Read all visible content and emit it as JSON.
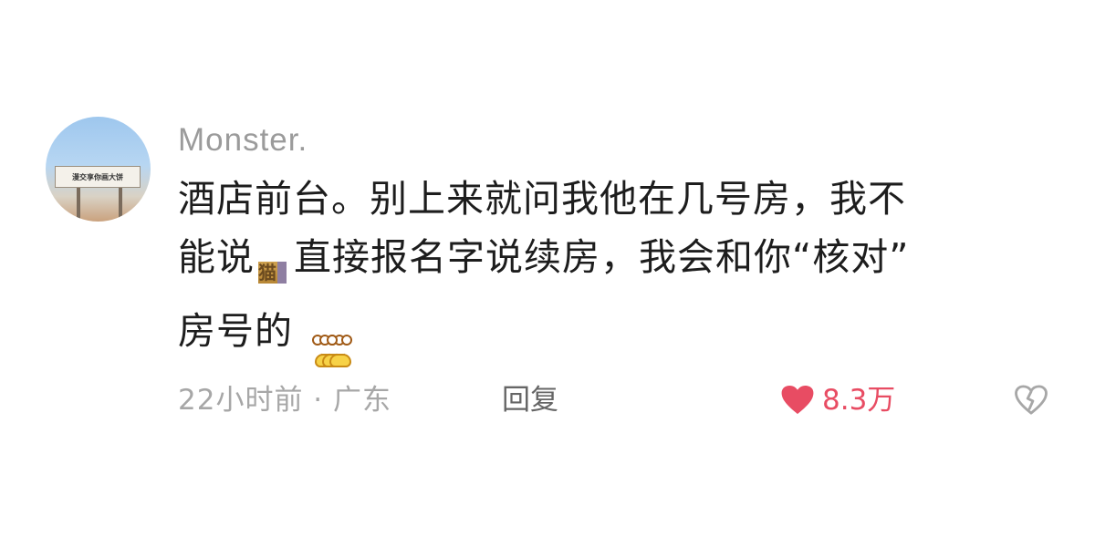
{
  "comment": {
    "avatar": {
      "sign_text": "漫交享你画大饼"
    },
    "username": "Monster.",
    "content": {
      "line1": "酒店前台。别上来就问我他在几号房，我不",
      "line2_start": "能说",
      "cat_emoji": "猫",
      "line2_end": "直接报名字说续房，我会和你“核对”",
      "line3": "房号的",
      "thinking_emoji_count": 3
    },
    "meta": {
      "time_location": "22小时前 · 广东",
      "reply_label": "回复",
      "likes": "8.3万"
    }
  },
  "colors": {
    "text": "#1d1d1d",
    "meta": "#a7a7a7",
    "reply": "#666666",
    "like": "#e84c63",
    "background": "#ffffff"
  },
  "icons": {
    "like": "heart-icon",
    "dislike": "broken-heart-icon"
  }
}
